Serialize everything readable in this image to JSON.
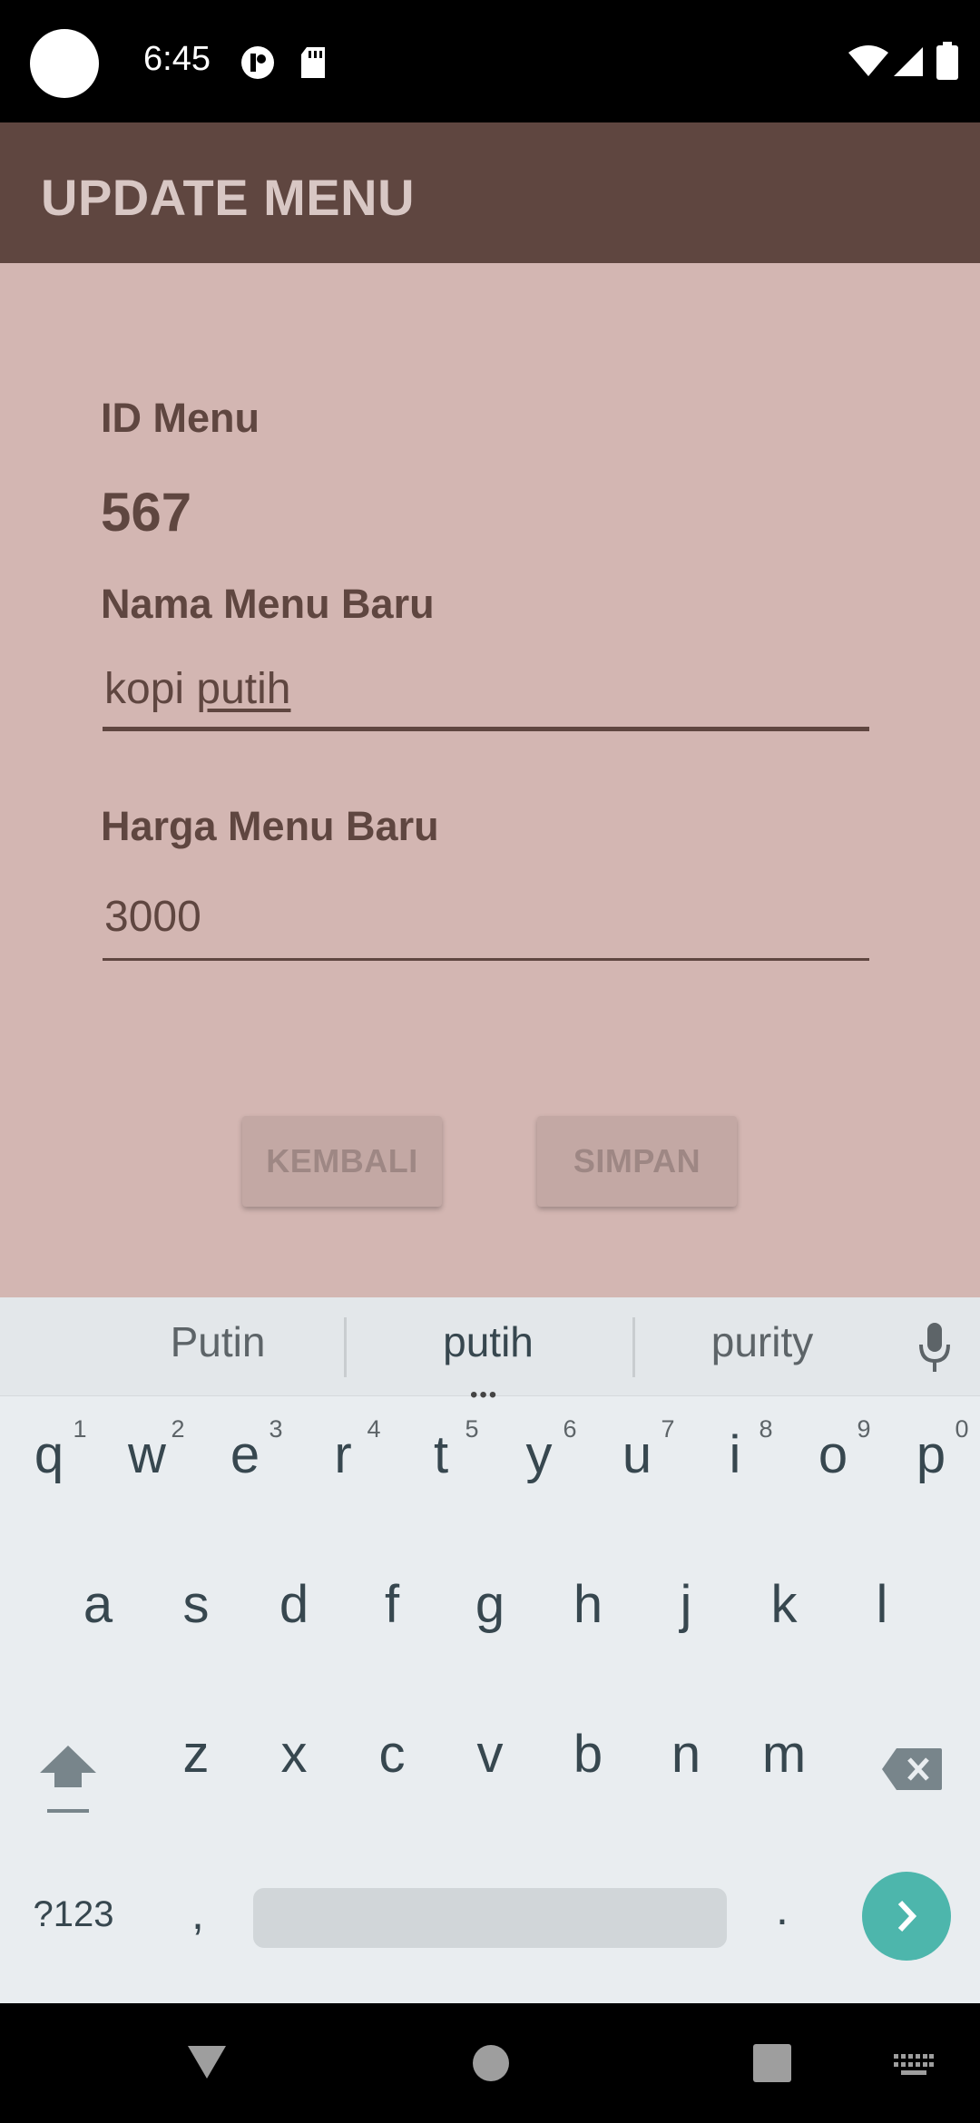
{
  "status_bar": {
    "time": "6:45",
    "icons": [
      "camera-cutout",
      "notification-icon",
      "sd-card-icon",
      "wifi-icon",
      "signal-icon",
      "battery-icon"
    ]
  },
  "app_bar": {
    "title": "UPDATE MENU"
  },
  "form": {
    "id_label": "ID Menu",
    "id_value": "567",
    "name_label": "Nama Menu Baru",
    "name_value_prefix": "kopi ",
    "name_value_current_word": "putih",
    "price_label": "Harga Menu Baru",
    "price_value": "3000"
  },
  "buttons": {
    "back": "KEMBALI",
    "save": "SIMPAN"
  },
  "keyboard": {
    "suggestions": [
      "Putin",
      "putih",
      "purity"
    ],
    "row1": [
      "q",
      "w",
      "e",
      "r",
      "t",
      "y",
      "u",
      "i",
      "o",
      "p"
    ],
    "row1_numbers": [
      "1",
      "2",
      "3",
      "4",
      "5",
      "6",
      "7",
      "8",
      "9",
      "0"
    ],
    "row2": [
      "a",
      "s",
      "d",
      "f",
      "g",
      "h",
      "j",
      "k",
      "l"
    ],
    "row3": [
      "z",
      "x",
      "c",
      "v",
      "b",
      "n",
      "m"
    ],
    "symbols_key": "?123",
    "comma_key": ",",
    "period_key": "."
  },
  "colors": {
    "app_bar": "#5f4640",
    "content_bg": "#d3b6b2",
    "text_primary": "#5f4640",
    "keyboard_bg": "#e9edf0",
    "enter_key": "#4db6ac"
  }
}
